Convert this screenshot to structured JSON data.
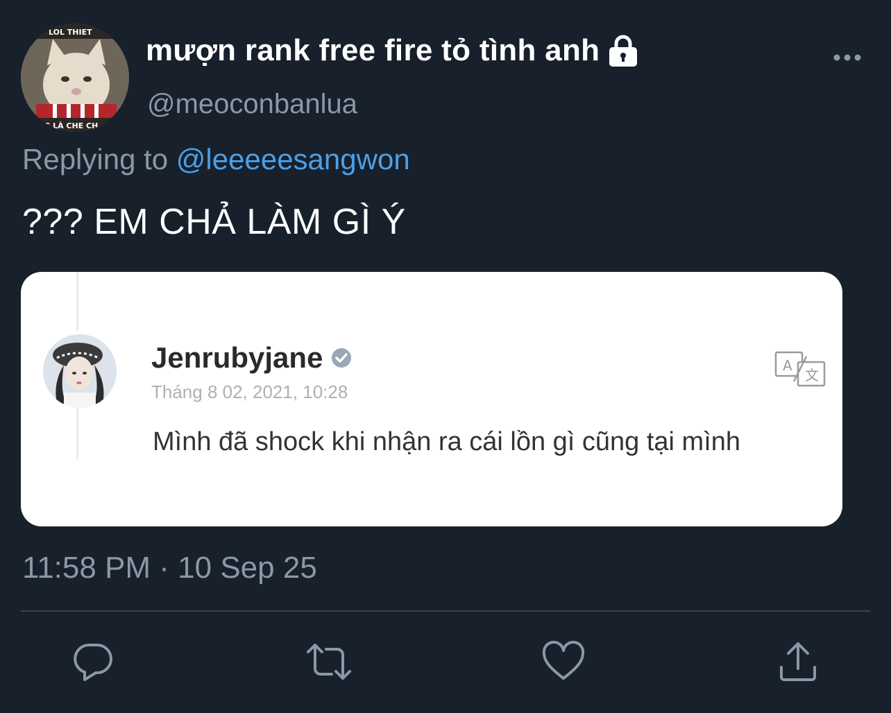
{
  "tweet": {
    "display_name": "mượn rank free fire tỏ tình anh",
    "handle": "@meoconbanlua",
    "reply_prefix": "Replying to",
    "reply_mention": "@leeeeesangwon",
    "text": "??? EM CHẢ LÀM GÌ Ý",
    "timestamp": "11:58 PM · 10 Sep 25",
    "avatar_caption_top": "LOL THIET",
    "avatar_caption_bottom": "NG LÀ CHE CH"
  },
  "embedded_post": {
    "name": "Jenrubyjane",
    "date": "Tháng 8 02, 2021, 10:28",
    "text": "Mình đã shock khi nhận ra cái lồn gì cũng tại mình",
    "translate_glyph_a": "A",
    "translate_glyph_b": "文"
  },
  "icons": {
    "lock": "lock-icon",
    "more": "more-icon",
    "verified": "verified-icon",
    "translate": "translate-icon",
    "reply": "reply-icon",
    "retweet": "retweet-icon",
    "like": "heart-icon",
    "share": "share-icon"
  },
  "colors": {
    "background": "#17202b",
    "secondary_text": "#8b98a5",
    "link": "#4d9fe6",
    "divider": "#38444d"
  }
}
